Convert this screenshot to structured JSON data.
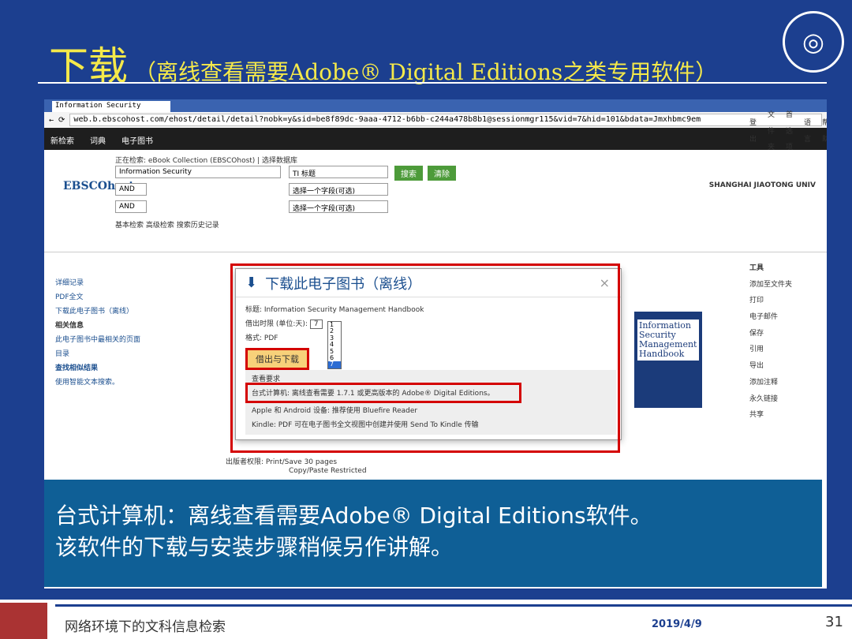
{
  "slide": {
    "title": "下载",
    "subtitle": "（离线查看需要Adobe® Digital Editions之类专用软件）",
    "caption_line1": "台式计算机：离线查看需要Adobe® Digital Editions软件。",
    "caption_line2": "该软件的下载与安装步骤稍候另作讲解。",
    "footer_text": "网络环境下的文科信息检索",
    "date": "2019/4/9",
    "page": "31"
  },
  "browser": {
    "tab": "Information Security",
    "url": "web.b.ebscohost.com/ehost/detail/detail?nobk=y&sid=be8f89dc-9aaa-4712-b6bb-c244a478b8b1@sessionmgr115&vid=7&hid=101&bdata=Jmxhbmc9em"
  },
  "ebsco": {
    "nav": [
      "新检索",
      "词典",
      "电子图书"
    ],
    "nav_right": [
      "登出",
      "文件夹",
      "首选项",
      "语言",
      "帮助",
      "退出"
    ],
    "searching": "正在检索: eBook Collection (EBSCOhost) | 选择数据库",
    "query": "Information Security",
    "field": "TI 标题",
    "search_btn": "搜索",
    "clear_btn": "清除",
    "and1": "AND",
    "and2": "AND",
    "choose_field": "选择一个字段(可选)",
    "links": "基本检索 高级检索 搜索历史记录",
    "univ": "SHANGHAI JIAOTONG UNIV",
    "logo": "EBSCOhost"
  },
  "left_panel": [
    "详细记录",
    "PDF全文",
    "下载此电子图书（离线）",
    "相关信息",
    "此电子图书中最相关的页面",
    "目录",
    "查找相似结果",
    "使用智能文本搜索。"
  ],
  "right_panel": [
    "工具",
    "添加至文件夹",
    "打印",
    "电子邮件",
    "保存",
    "引用",
    "导出",
    "添加注释",
    "永久链接",
    "共享"
  ],
  "modal": {
    "title": "下载此电子图书（离线）",
    "title_row": "标题: Information Security Management Handbook",
    "loan_row": "借出时限 (单位:天):",
    "loan_value": "7",
    "options": [
      "1",
      "2",
      "3",
      "4",
      "5",
      "6",
      "7"
    ],
    "format_row": "格式: PDF",
    "download_btn": "借出与下载",
    "requirements": "查看要求",
    "desktop": "台式计算机: 离线查看需要 1.7.1 或更高版本的 Adobe® Digital Editions。",
    "apple": "Apple 和 Android 设备: 推荐使用 Bluefire Reader",
    "kindle": "Kindle: PDF 可在电子图书全文视图中创建并使用 Send To Kindle 传输",
    "book_title": "Information Security Management Handbook"
  },
  "below": {
    "rights": "出版者权限: Print/Save 30 pages",
    "copy": "Copy/Paste Restricted"
  }
}
